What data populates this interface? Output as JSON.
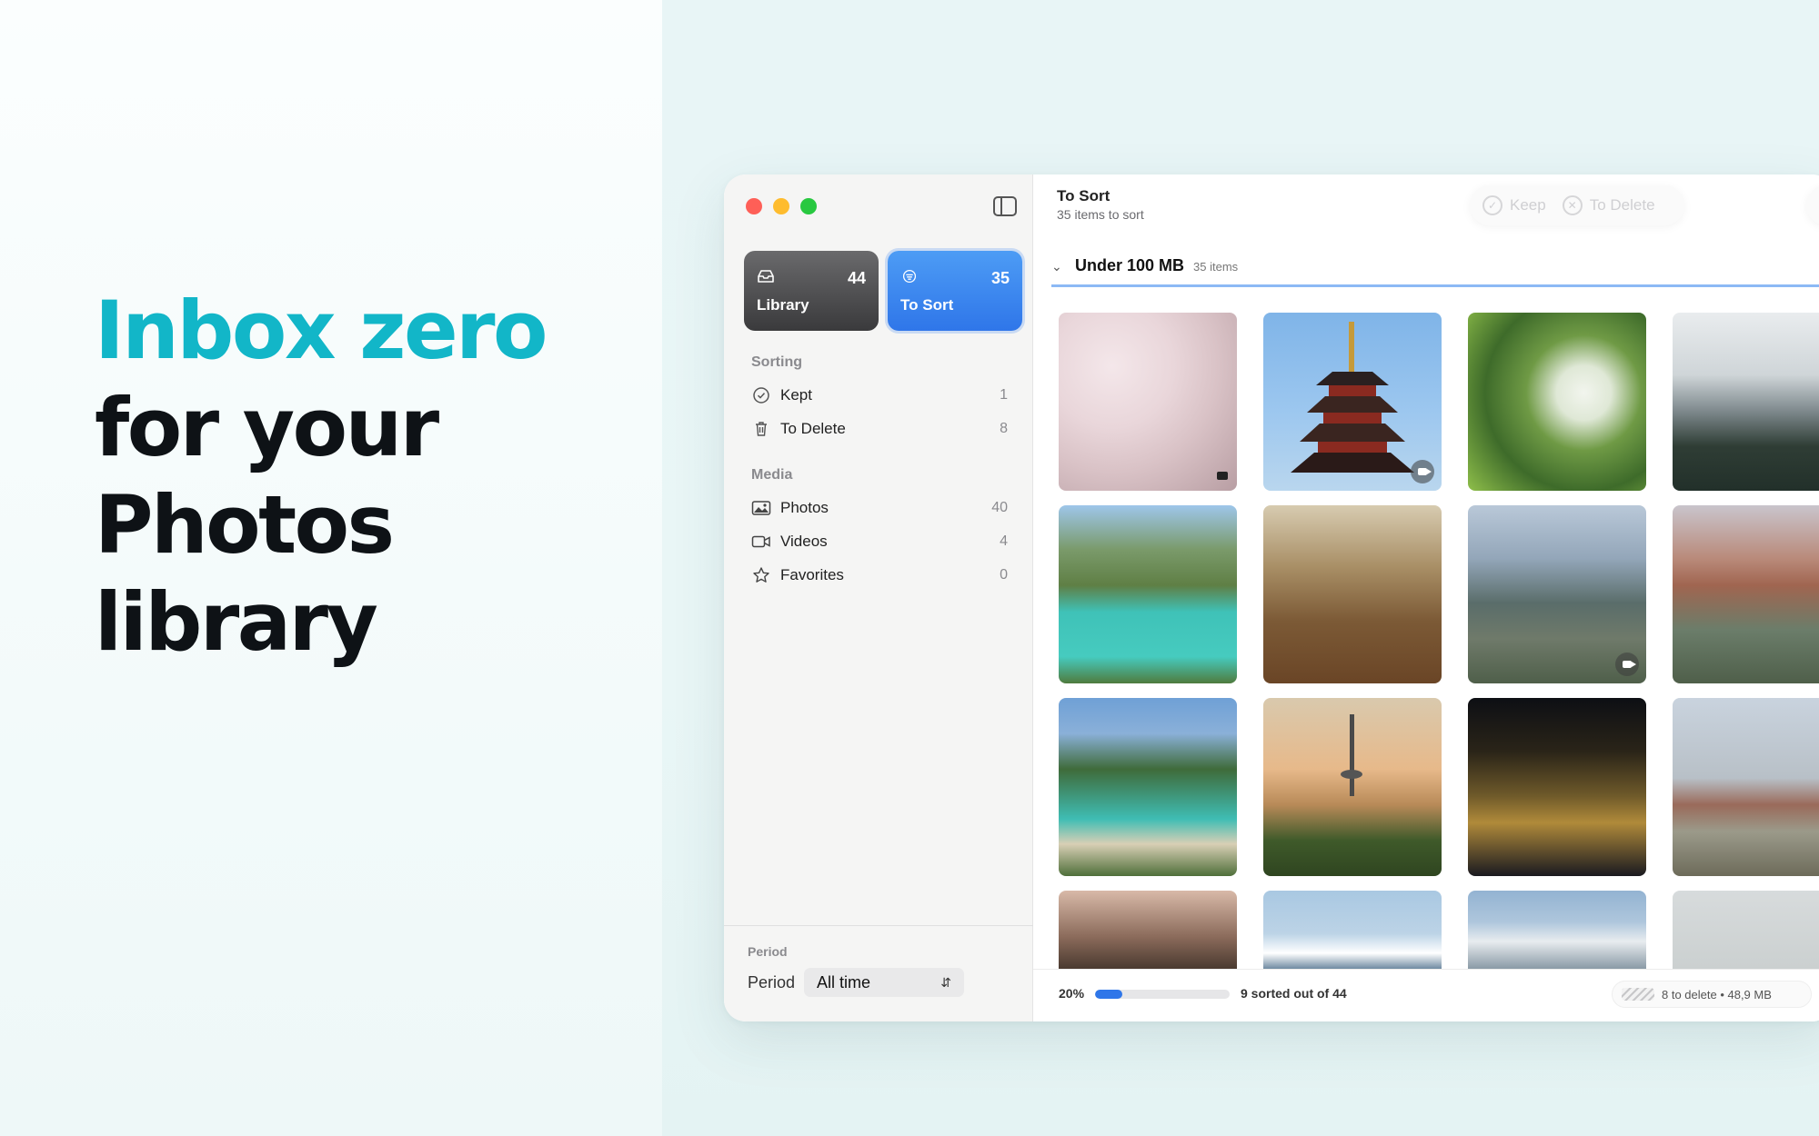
{
  "headline": {
    "line1": "Inbox zero",
    "line2": "for your",
    "line3": "Photos",
    "line4": "library"
  },
  "colors": {
    "accent": "#12b6c8",
    "primary_blue": "#2f76e9",
    "library_card": "#3a3a3c"
  },
  "sidebar": {
    "cards": [
      {
        "label": "Library",
        "count": "44",
        "icon": "tray-icon"
      },
      {
        "label": "To Sort",
        "count": "35",
        "icon": "inbox-sort-icon"
      }
    ],
    "sorting_title": "Sorting",
    "sorting_items": [
      {
        "label": "Kept",
        "count": "1",
        "icon": "checkmark-circle-icon"
      },
      {
        "label": "To Delete",
        "count": "8",
        "icon": "trash-icon"
      }
    ],
    "media_title": "Media",
    "media_items": [
      {
        "label": "Photos",
        "count": "40",
        "icon": "photo-icon"
      },
      {
        "label": "Videos",
        "count": "4",
        "icon": "video-icon"
      },
      {
        "label": "Favorites",
        "count": "0",
        "icon": "star-icon"
      }
    ],
    "footer": {
      "section_label": "Period",
      "field_label": "Period",
      "selected": "All time"
    }
  },
  "main": {
    "title": "To Sort",
    "subtitle": "35 items to sort",
    "actions": {
      "keep": "Keep",
      "to_delete": "To Delete"
    },
    "group": {
      "name": "Under 100 MB",
      "count": "35 items"
    },
    "thumbnails": [
      {
        "subject": "cherry blossoms",
        "video": true
      },
      {
        "subject": "pagoda",
        "video": true
      },
      {
        "subject": "white flowers garden",
        "video": false
      },
      {
        "subject": "snowy mountains forest",
        "video": false
      },
      {
        "subject": "turquoise cove",
        "video": false
      },
      {
        "subject": "autumn forest",
        "video": false
      },
      {
        "subject": "city from hill",
        "video": true
      },
      {
        "subject": "red rock mountains",
        "video": false
      },
      {
        "subject": "beach cove cliffs",
        "video": false
      },
      {
        "subject": "tower at sunset",
        "video": false
      },
      {
        "subject": "city skyline night",
        "video": false
      },
      {
        "subject": "train station",
        "video": false
      },
      {
        "subject": "street wires",
        "video": false
      },
      {
        "subject": "mount fuji",
        "video": false
      },
      {
        "subject": "snowy hill",
        "video": false
      },
      {
        "subject": "foggy landscape",
        "video": false
      }
    ],
    "progress": {
      "percent_label": "20%",
      "fraction": 0.2,
      "sorted_text": "9 sorted out of 44",
      "delete_info": "8 to delete • 48,9 MB"
    }
  }
}
